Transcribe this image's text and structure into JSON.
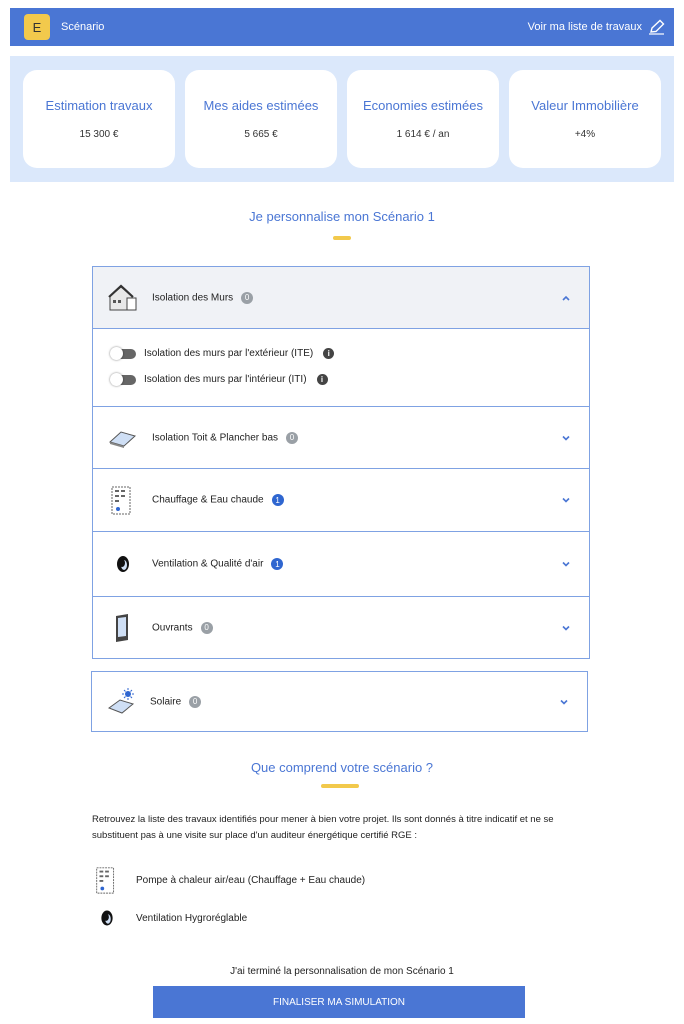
{
  "header": {
    "grade": "E",
    "scenario": "Scénario",
    "list_link": "Voir ma liste de travaux"
  },
  "kpis": [
    {
      "label": "Estimation travaux",
      "value": "15 300 €"
    },
    {
      "label": "Mes aides estimées",
      "value": "5 665 €"
    },
    {
      "label": "Economies estimées",
      "value": "1 614 € / an"
    },
    {
      "label": "Valeur Immobilière",
      "value": "+4%"
    }
  ],
  "personalize_title": "Je personnalise mon Scénario 1",
  "accordion": [
    {
      "title": "Isolation des Murs",
      "count": "0",
      "expanded": true,
      "options": [
        {
          "label": "Isolation des murs par l'extérieur (ITE)"
        },
        {
          "label": "Isolation des murs par l'intérieur (ITI)"
        }
      ]
    },
    {
      "title": "Isolation Toit & Plancher bas",
      "count": "0"
    },
    {
      "title": "Chauffage & Eau chaude",
      "count": "1"
    },
    {
      "title": "Ventilation & Qualité d'air",
      "count": "1"
    },
    {
      "title": "Ouvrants",
      "count": "0"
    },
    {
      "title": "Solaire",
      "count": "0"
    }
  ],
  "summary_title": "Que comprend votre scénario ?",
  "summary_text": "Retrouvez la liste des travaux identifiés pour mener à bien votre projet. Ils sont donnés à titre indicatif et ne se substituent pas à une visite sur place d'un auditeur énergétique certifié RGE :",
  "summary_items": [
    {
      "label": "Pompe à chaleur air/eau (Chauffage + Eau chaude)"
    },
    {
      "label": "Ventilation Hygroréglable"
    }
  ],
  "final_label": "J'ai terminé la personnalisation de mon Scénario 1",
  "cta": "FINALISER MA SIMULATION",
  "info_glyph": "i",
  "colors": {
    "primary": "#4a76d4",
    "accent": "#f2c94c",
    "panel": "#dbe8fb"
  }
}
